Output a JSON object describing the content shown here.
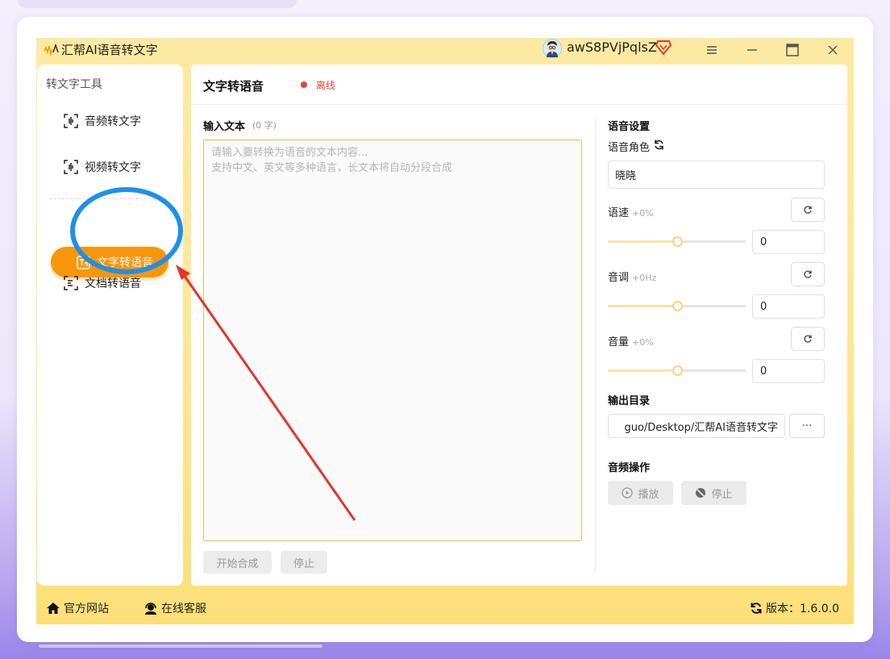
{
  "app": {
    "title": "汇帮AI语音转文字",
    "username": "awS8PVjPqlsZ"
  },
  "sidebar": {
    "section_title": "转文字工具",
    "items": [
      {
        "label": "音频转文字"
      },
      {
        "label": "视频转文字"
      },
      {
        "label": "文字转语音"
      },
      {
        "label": "文档转语音"
      }
    ]
  },
  "main": {
    "title": "文字转语音",
    "status": "离线",
    "input_label": "输入文本",
    "input_count": "(0 字)",
    "placeholder": "请输入要转换为语音的文本内容...\n支持中文、英文等多种语言，长文本将自动分段合成",
    "start_button": "开始合成",
    "stop_button": "停止"
  },
  "settings": {
    "title": "语音设置",
    "voice_label": "语音角色",
    "voice_value": "晓晓",
    "speed_label": "语速",
    "speed_sub": "+0%",
    "speed_value": "0",
    "pitch_label": "音调",
    "pitch_sub": "+0Hz",
    "pitch_value": "0",
    "volume_label": "音量",
    "volume_sub": "+0%",
    "volume_value": "0",
    "slider_level": 0.5,
    "output_label": "输出目录",
    "output_path": "guo/Desktop/汇帮AI语音转文字",
    "browse_label": "···",
    "audio_ops_label": "音频操作",
    "play_button": "播放",
    "stop_button": "停止"
  },
  "footer": {
    "website": "官方网站",
    "support": "在线客服",
    "version": "版本：1.6.0.0"
  },
  "colors": {
    "accent": "#f9960a",
    "window_bg": "#fde79a",
    "status_red": "#e2433a",
    "annotation_blue": "#1e90ea",
    "annotation_red": "#e8322b"
  }
}
